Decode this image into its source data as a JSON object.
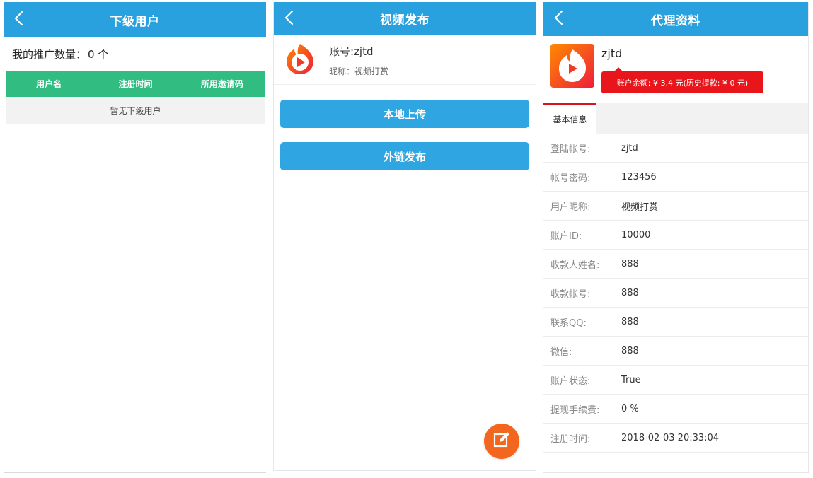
{
  "sub_users": {
    "header": {
      "title": "下级用户"
    },
    "promo_label": "我的推广数量：",
    "promo_count": "0 个",
    "table": {
      "columns": [
        "用户名",
        "注册时间",
        "所用邀请码"
      ],
      "empty_text": "暂无下级用户"
    }
  },
  "video_publish": {
    "header": {
      "title": "视频发布"
    },
    "account": {
      "username": "账号:zjtd",
      "nickname": "昵称：视频打赏"
    },
    "buttons": {
      "local_upload": "本地上传",
      "link_publish": "外链发布"
    }
  },
  "agent_profile": {
    "header": {
      "title": "代理资料"
    },
    "name": "zjtd",
    "balance_text": "账户余额: ¥ 3.4 元(历史提款: ¥ 0 元)",
    "tab": "基本信息",
    "rows": [
      {
        "label": "登陆帐号:",
        "value": "zjtd"
      },
      {
        "label": "帐号密码:",
        "value": "123456"
      },
      {
        "label": "用户昵称:",
        "value": "视频打赏"
      },
      {
        "label": "账户ID:",
        "value": "10000"
      },
      {
        "label": "收款人姓名:",
        "value": "888"
      },
      {
        "label": "收款帐号:",
        "value": "888"
      },
      {
        "label": "联系QQ:",
        "value": "888"
      },
      {
        "label": "微信:",
        "value": "888"
      },
      {
        "label": "账户状态:",
        "value": "True"
      },
      {
        "label": "提现手续费:",
        "value": "0 %"
      },
      {
        "label": "注册时间:",
        "value": "2018-02-03 20:33:04"
      }
    ]
  },
  "icons": {
    "back": "chevron-left-icon",
    "logo": "flame-play-logo",
    "fab": "edit-icon"
  },
  "colors": {
    "header": "#2aa1df",
    "table_header": "#31bd82",
    "button": "#2fa6e1",
    "fab": "#f2661d",
    "balance_badge": "#e8151b"
  }
}
